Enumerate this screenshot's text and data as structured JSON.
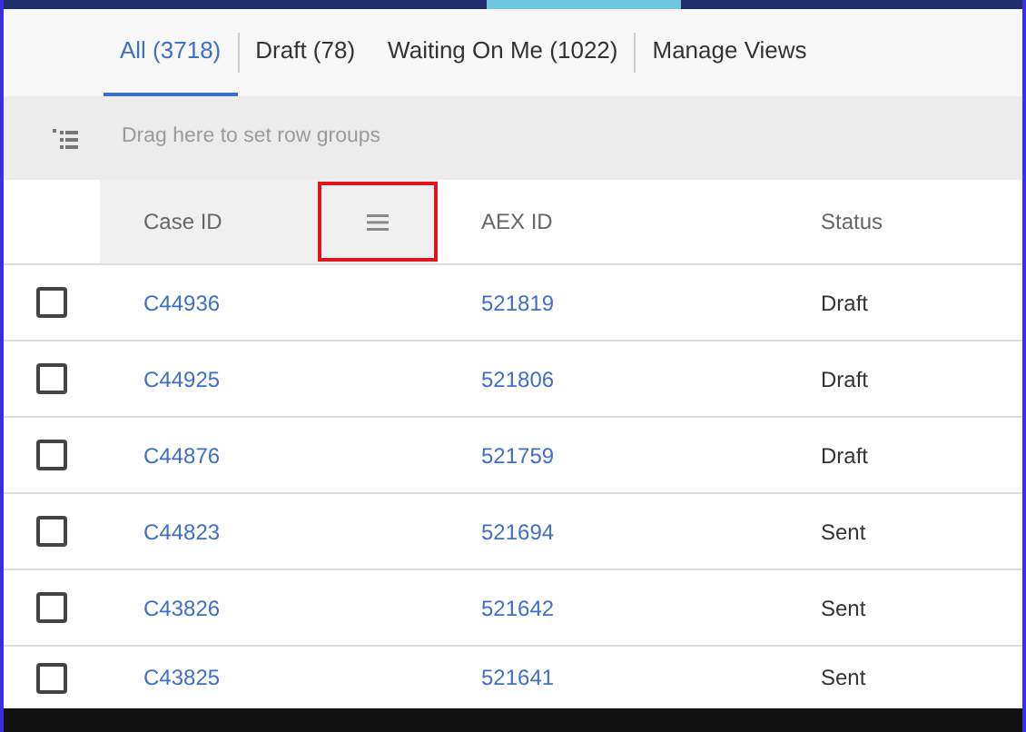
{
  "tabs": [
    {
      "label": "All (3718)",
      "selected": true
    },
    {
      "label": "Draft (78)",
      "selected": false
    },
    {
      "label": "Waiting On Me (1022)",
      "selected": false
    },
    {
      "label": "Manage Views",
      "selected": false
    }
  ],
  "group_bar": {
    "placeholder": "Drag here to set row groups"
  },
  "table": {
    "columns": [
      {
        "label": "Case ID",
        "menu_highlighted": true
      },
      {
        "label": "AEX ID",
        "menu_highlighted": false
      },
      {
        "label": "Status",
        "menu_highlighted": false
      }
    ],
    "rows": [
      {
        "checked": false,
        "cells": [
          "C44936",
          "521819",
          "Draft"
        ]
      },
      {
        "checked": false,
        "cells": [
          "C44925",
          "521806",
          "Draft"
        ]
      },
      {
        "checked": false,
        "cells": [
          "C44876",
          "521759",
          "Draft"
        ]
      },
      {
        "checked": false,
        "cells": [
          "C44823",
          "521694",
          "Sent"
        ]
      },
      {
        "checked": false,
        "cells": [
          "C43826",
          "521642",
          "Sent"
        ]
      },
      {
        "checked": false,
        "cells": [
          "C43825",
          "521641",
          "Sent"
        ]
      }
    ]
  }
}
